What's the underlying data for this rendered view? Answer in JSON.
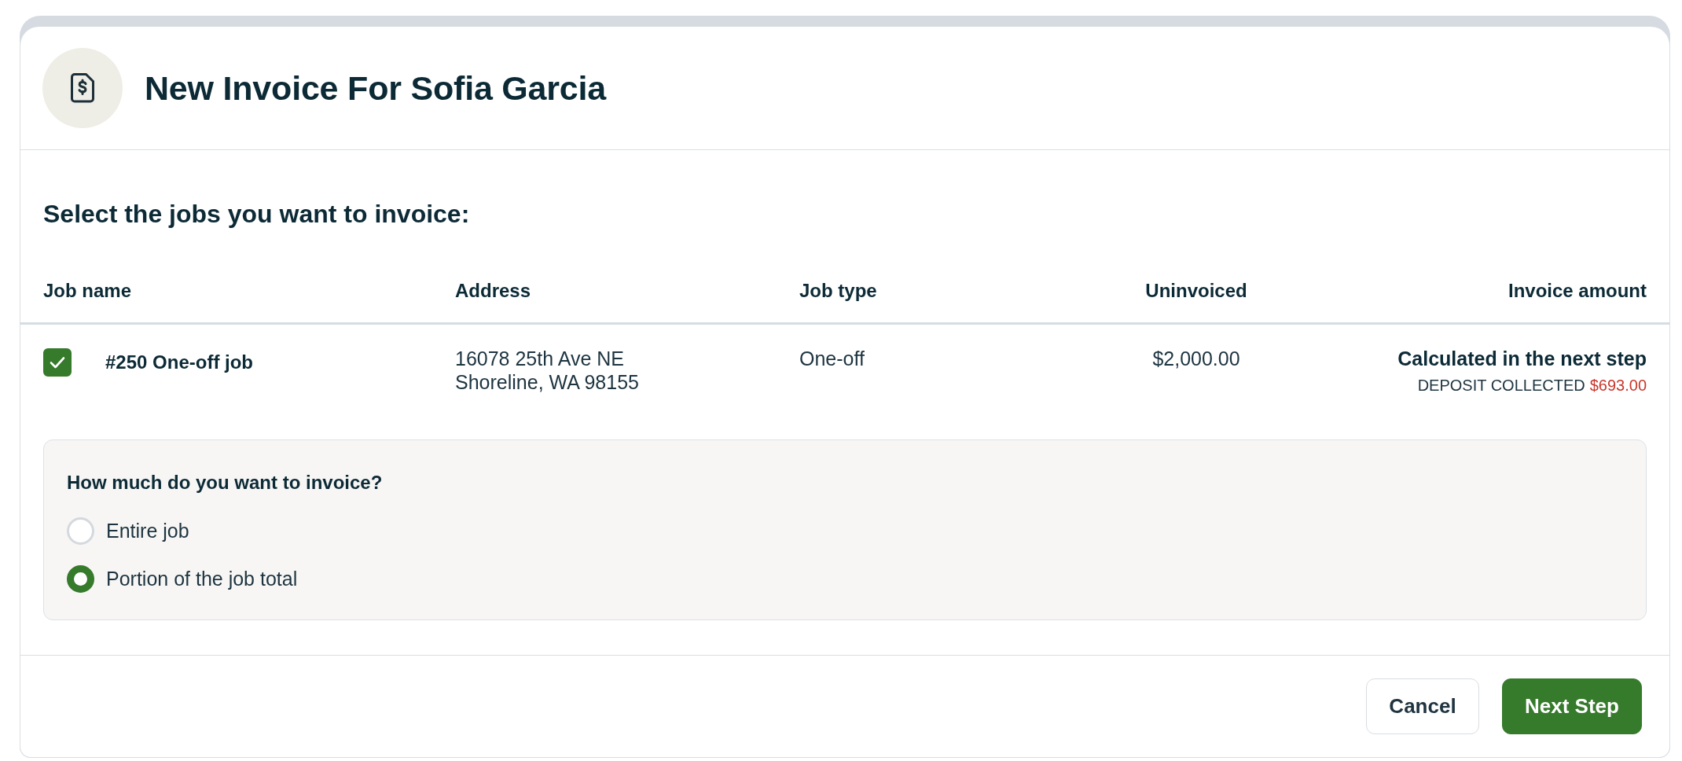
{
  "dialog": {
    "title": "New Invoice For Sofia Garcia"
  },
  "prompt": "Select the jobs you want to invoice:",
  "table": {
    "columns": [
      "Job name",
      "Address",
      "Job type",
      "Uninvoiced",
      "Invoice amount"
    ],
    "rows": [
      {
        "checked": true,
        "job_name": "#250 One-off job",
        "address": [
          "16078 25th Ave NE",
          "Shoreline, WA 98155"
        ],
        "job_type": "One-off",
        "uninvoiced": "$2,000.00",
        "invoice_amount": "Calculated in the next step",
        "deposit_label": "DEPOSIT COLLECTED",
        "deposit_amount": "$693.00",
        "invoice_options": {
          "question": "How much do you want to invoice?",
          "options": [
            {
              "label": "Entire job",
              "selected": false
            },
            {
              "label": "Portion of the job total",
              "selected": true
            }
          ]
        }
      }
    ]
  },
  "buttons": [
    {
      "label": "Cancel",
      "kind": "secondary"
    },
    {
      "label": "Next Step",
      "kind": "primary"
    }
  ]
}
